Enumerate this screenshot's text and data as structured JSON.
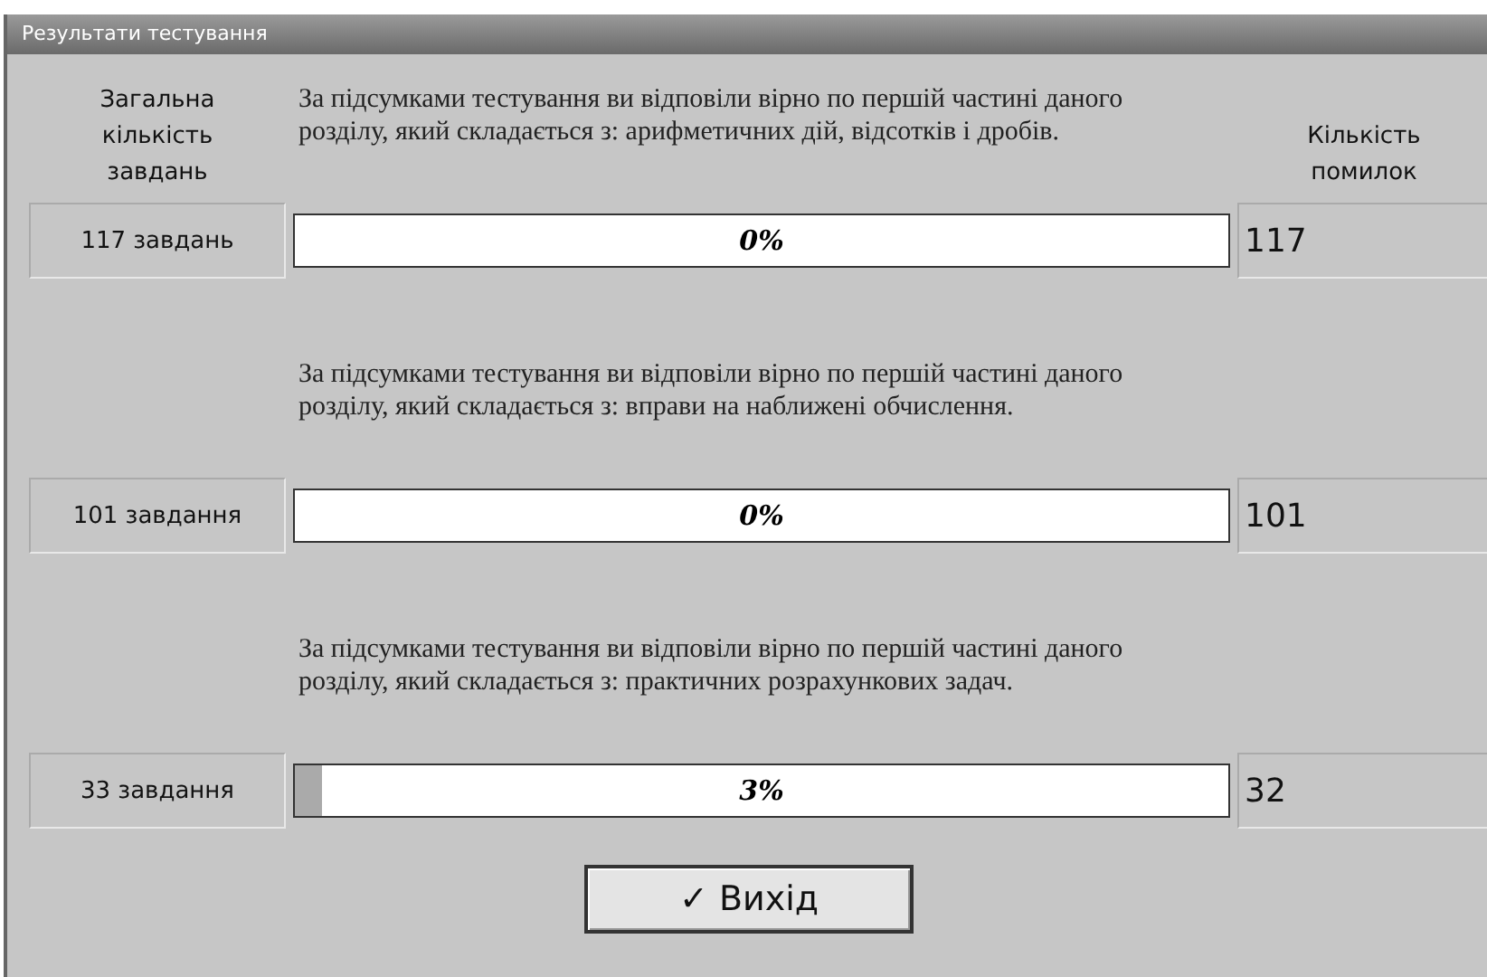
{
  "window": {
    "title": "Результати тестування"
  },
  "headers": {
    "total": "Загальна кількість завдань",
    "errors": "Кількість помилок"
  },
  "sections": [
    {
      "description": "За підсумками тестування ви відповіли вірно по першій частині даного розділу, який складається з: арифметичних дій, відсотків і дробів.",
      "total": "117 завдань",
      "level": 0,
      "percent": "0%",
      "errors": "117"
    },
    {
      "description": "За підсумками тестування ви відповіли вірно по першій частині даного розділу, який складається з: вправи на наближені обчислення.",
      "total": "101 завдання",
      "level": 0,
      "percent": "0%",
      "errors": "101"
    },
    {
      "description": "За підсумками тестування ви відповіли вірно по першій частині даного розділу, який складається з: практичних розрахункових задач.",
      "total": "33 завдання",
      "level": 0.03,
      "percent": "3%",
      "errors": "32"
    }
  ],
  "button": {
    "label": "Вихід",
    "icon": "✓"
  }
}
